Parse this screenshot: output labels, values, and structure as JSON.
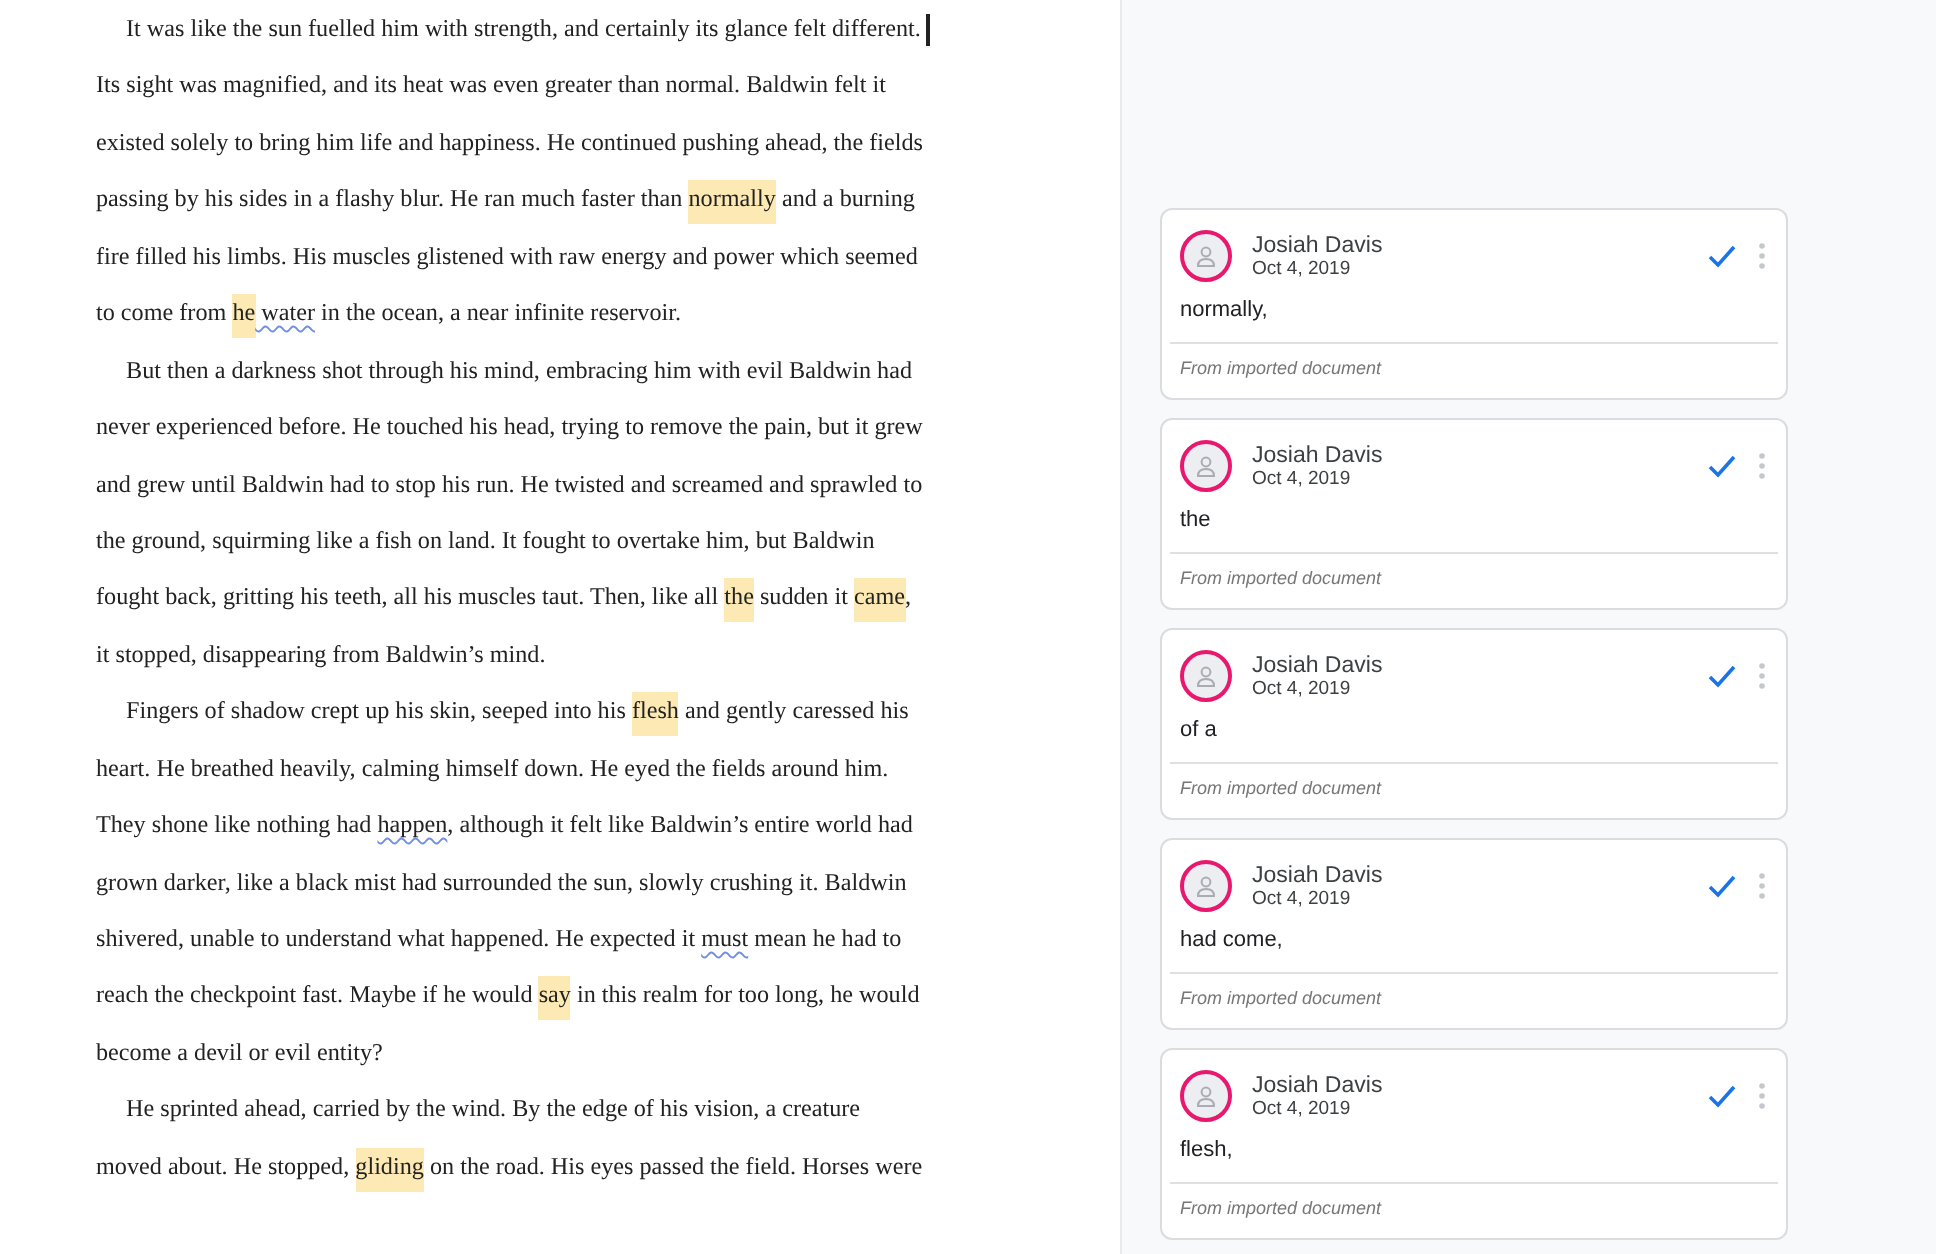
{
  "document": {
    "lines": [
      {
        "indent": true,
        "segments": [
          {
            "text": "It was like the sun fuelled him with strength, and certainly its glance felt different.",
            "kind": "plain"
          }
        ]
      },
      {
        "indent": false,
        "segments": [
          {
            "text": "Its sight was magnified, and its heat was even greater than normal. Baldwin felt it",
            "kind": "plain"
          }
        ]
      },
      {
        "indent": false,
        "segments": [
          {
            "text": "existed solely to bring him life and happiness. He continued pushing ahead, the fields",
            "kind": "plain"
          }
        ]
      },
      {
        "indent": false,
        "segments": [
          {
            "text": "passing by his sides in a flashy blur. He ran much faster than ",
            "kind": "plain"
          },
          {
            "text": "normally",
            "kind": "highlight"
          },
          {
            "text": " and a burning",
            "kind": "plain"
          }
        ]
      },
      {
        "indent": false,
        "segments": [
          {
            "text": "fire filled his limbs. His muscles glistened with raw energy and power which seemed",
            "kind": "plain"
          }
        ]
      },
      {
        "indent": false,
        "segments": [
          {
            "text": "to come from ",
            "kind": "plain"
          },
          {
            "text": "he",
            "kind": "highlight"
          },
          {
            "text": " water",
            "kind": "spelling"
          },
          {
            "text": " in the ocean, a near infinite reservoir.",
            "kind": "plain"
          }
        ]
      },
      {
        "indent": true,
        "segments": [
          {
            "text": "But then a darkness shot through his mind, embracing him with evil Baldwin had",
            "kind": "plain"
          }
        ]
      },
      {
        "indent": false,
        "segments": [
          {
            "text": "never experienced before. He touched his head, trying to remove the pain, but it grew",
            "kind": "plain"
          }
        ]
      },
      {
        "indent": false,
        "segments": [
          {
            "text": "and grew until Baldwin had to stop his run. He twisted and screamed and sprawled to",
            "kind": "plain"
          }
        ]
      },
      {
        "indent": false,
        "segments": [
          {
            "text": "the ground, squirming like a fish on land. It fought to overtake him, but Baldwin",
            "kind": "plain"
          }
        ]
      },
      {
        "indent": false,
        "segments": [
          {
            "text": "fought back, gritting his teeth, all his muscles taut. Then, like all ",
            "kind": "plain"
          },
          {
            "text": "the",
            "kind": "highlight"
          },
          {
            "text": " sudden it ",
            "kind": "plain"
          },
          {
            "text": "came",
            "kind": "highlight"
          },
          {
            "text": ",",
            "kind": "plain"
          }
        ]
      },
      {
        "indent": false,
        "segments": [
          {
            "text": "it stopped, disappearing from Baldwin’s mind.",
            "kind": "plain"
          }
        ]
      },
      {
        "indent": true,
        "segments": [
          {
            "text": "Fingers of shadow crept up his skin, seeped into his ",
            "kind": "plain"
          },
          {
            "text": "flesh",
            "kind": "highlight"
          },
          {
            "text": " and gently caressed his",
            "kind": "plain"
          }
        ]
      },
      {
        "indent": false,
        "segments": [
          {
            "text": "heart. He breathed heavily, calming himself down. He eyed the fields around him.",
            "kind": "plain"
          }
        ]
      },
      {
        "indent": false,
        "segments": [
          {
            "text": "They shone like nothing had ",
            "kind": "plain"
          },
          {
            "text": "happen",
            "kind": "spelling"
          },
          {
            "text": ", although it felt like Baldwin’s entire world had",
            "kind": "plain"
          }
        ]
      },
      {
        "indent": false,
        "segments": [
          {
            "text": "grown darker, like a black mist had surrounded the sun, slowly crushing it. Baldwin",
            "kind": "plain"
          }
        ]
      },
      {
        "indent": false,
        "segments": [
          {
            "text": "shivered, unable to understand what happened. He expected it ",
            "kind": "plain"
          },
          {
            "text": "must",
            "kind": "spelling"
          },
          {
            "text": " mean he had to",
            "kind": "plain"
          }
        ]
      },
      {
        "indent": false,
        "segments": [
          {
            "text": "reach the checkpoint fast. Maybe if he would ",
            "kind": "plain"
          },
          {
            "text": "say",
            "kind": "highlight"
          },
          {
            "text": " in this realm for too long, he would",
            "kind": "plain"
          }
        ]
      },
      {
        "indent": false,
        "segments": [
          {
            "text": "become a devil or evil entity?",
            "kind": "plain"
          }
        ]
      },
      {
        "indent": true,
        "segments": [
          {
            "text": "He sprinted ahead, carried by the wind. By the edge of his vision, a creature",
            "kind": "plain"
          }
        ]
      },
      {
        "indent": false,
        "segments": [
          {
            "text": "moved about. He stopped, ",
            "kind": "plain"
          },
          {
            "text": "gliding",
            "kind": "highlight"
          },
          {
            "text": " on the road. His eyes passed the field. Horses were",
            "kind": "plain"
          }
        ]
      }
    ]
  },
  "comments": [
    {
      "author": "Josiah Davis",
      "date": "Oct 4, 2019",
      "text": "normally,",
      "source": "From imported document"
    },
    {
      "author": "Josiah Davis",
      "date": "Oct 4, 2019",
      "text": "the",
      "source": "From imported document"
    },
    {
      "author": "Josiah Davis",
      "date": "Oct 4, 2019",
      "text": "of a",
      "source": "From imported document"
    },
    {
      "author": "Josiah Davis",
      "date": "Oct 4, 2019",
      "text": "had come,",
      "source": "From imported document"
    },
    {
      "author": "Josiah Davis",
      "date": "Oct 4, 2019",
      "text": "flesh,",
      "source": "From imported document"
    }
  ]
}
